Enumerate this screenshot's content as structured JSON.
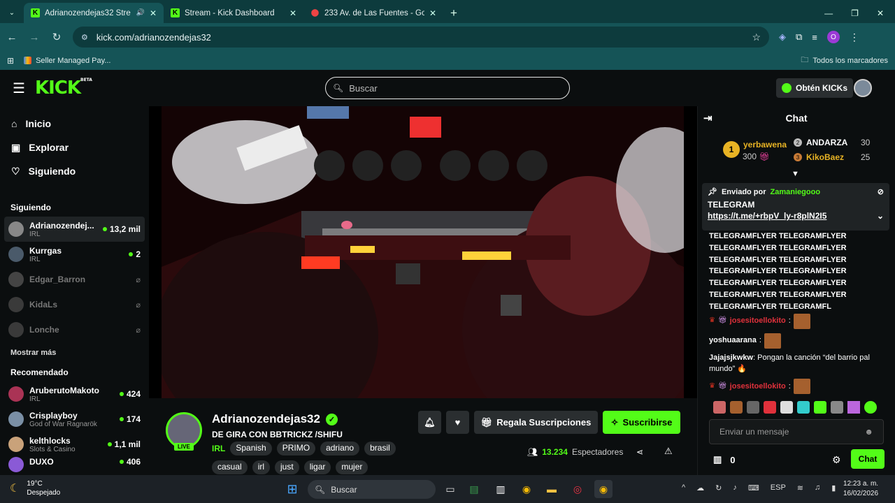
{
  "browser": {
    "tabs": [
      {
        "title": "Adrianozendejas32 Stream",
        "favicon": "K",
        "active": true
      },
      {
        "title": "Stream - Kick Dashboard",
        "favicon": "K",
        "active": false
      },
      {
        "title": "233 Av. de Las Fuentes - Googl",
        "favicon": "map-pin",
        "active": false
      }
    ],
    "url": "kick.com/adrianozendejas32",
    "bookmark": "Seller Managed Pay...",
    "all_bookmarks": "Todos los marcadores",
    "profile_initial": "O"
  },
  "header": {
    "logo": "KICK",
    "beta": "BETA",
    "search_placeholder": "Buscar",
    "kicks_label": "Obtén KICKs"
  },
  "sidebar": {
    "nav": [
      {
        "label": "Inicio",
        "icon": "home-icon"
      },
      {
        "label": "Explorar",
        "icon": "explore-icon"
      },
      {
        "label": "Siguiendo",
        "icon": "heart-icon"
      }
    ],
    "following_title": "Siguiendo",
    "following": [
      {
        "name": "Adrianozendej...",
        "category": "IRL",
        "viewers": "13,2 mil",
        "live": true
      },
      {
        "name": "Kurrgas",
        "category": "IRL",
        "viewers": "2",
        "live": true
      },
      {
        "name": "Edgar_Barron",
        "category": "",
        "viewers": "",
        "live": false
      },
      {
        "name": "KidaLs",
        "category": "",
        "viewers": "",
        "live": false
      },
      {
        "name": "Lonche",
        "category": "",
        "viewers": "",
        "live": false
      }
    ],
    "show_more": "Mostrar más",
    "recommended_title": "Recomendado",
    "recommended": [
      {
        "name": "AruberutoMakoto",
        "category": "IRL",
        "viewers": "424"
      },
      {
        "name": "Crisplayboy",
        "category": "God of War Ragnarök",
        "viewers": "174"
      },
      {
        "name": "kelthlocks",
        "category": "Slots & Casino",
        "viewers": "1,1 mil"
      },
      {
        "name": "DUXO",
        "category": "",
        "viewers": "406"
      }
    ]
  },
  "channel": {
    "name": "Adrianozendejas32",
    "live_badge": "LIVE",
    "title": "DE GIRA CON BBTRICKZ  /SHIFU",
    "category": "IRL",
    "tags": [
      "Spanish",
      "PRIMO",
      "adriano",
      "brasil",
      "casual",
      "irl",
      "just",
      "ligar",
      "mujer"
    ],
    "gift_label": "Regala Suscripciones",
    "subscribe_label": "Suscribirse",
    "viewers_count": "13.234",
    "viewers_label": "Espectadores"
  },
  "chat": {
    "title": "Chat",
    "leaderboard": {
      "first": {
        "rank": "1",
        "name": "yerbawena",
        "points": "300"
      },
      "second": {
        "rank": "2",
        "name": "ANDARZA",
        "points": "30"
      },
      "third": {
        "rank": "3",
        "name": "KikoBaez",
        "points": "25"
      }
    },
    "pinned": {
      "label": "Enviado por",
      "user": "Zamaniegooo",
      "text": "TELEGRAM",
      "link": "https://t.me/+rbpV_ly-r8plN2I5"
    },
    "spam_lines": [
      "TELEGRAMFLYER TELEGRAMFLYER",
      "TELEGRAMFLYER TELEGRAMFLYER",
      "TELEGRAMFLYER TELEGRAMFLYER",
      "TELEGRAMFLYER TELEGRAMFLYER",
      "TELEGRAMFLYER TELEGRAMFLYER",
      "TELEGRAMFLYER TELEGRAMFLYER",
      "TELEGRAMFLYER TELEGRAMFL"
    ],
    "messages": [
      {
        "user": "josesitoellokito",
        "text": ""
      },
      {
        "user": "yoshuaarana",
        "text": ""
      },
      {
        "user": "Jajajsjkwkw",
        "text": "Pongan la canción “del barrio pal mundo”"
      },
      {
        "user": "josesitoellokito",
        "text": ""
      }
    ],
    "input_placeholder": "Enviar un mensaje",
    "kicks_count": "0",
    "send_label": "Chat"
  },
  "taskbar": {
    "weather_temp": "19°C",
    "weather_desc": "Despejado",
    "search_label": "Buscar",
    "lang": "ESP",
    "time": "12:23 a. m.",
    "date": "16/02/2026"
  },
  "colors": {
    "kick_green": "#53fc18",
    "browser_teal": "#155457",
    "browser_dark_teal": "#0d3b3d"
  }
}
